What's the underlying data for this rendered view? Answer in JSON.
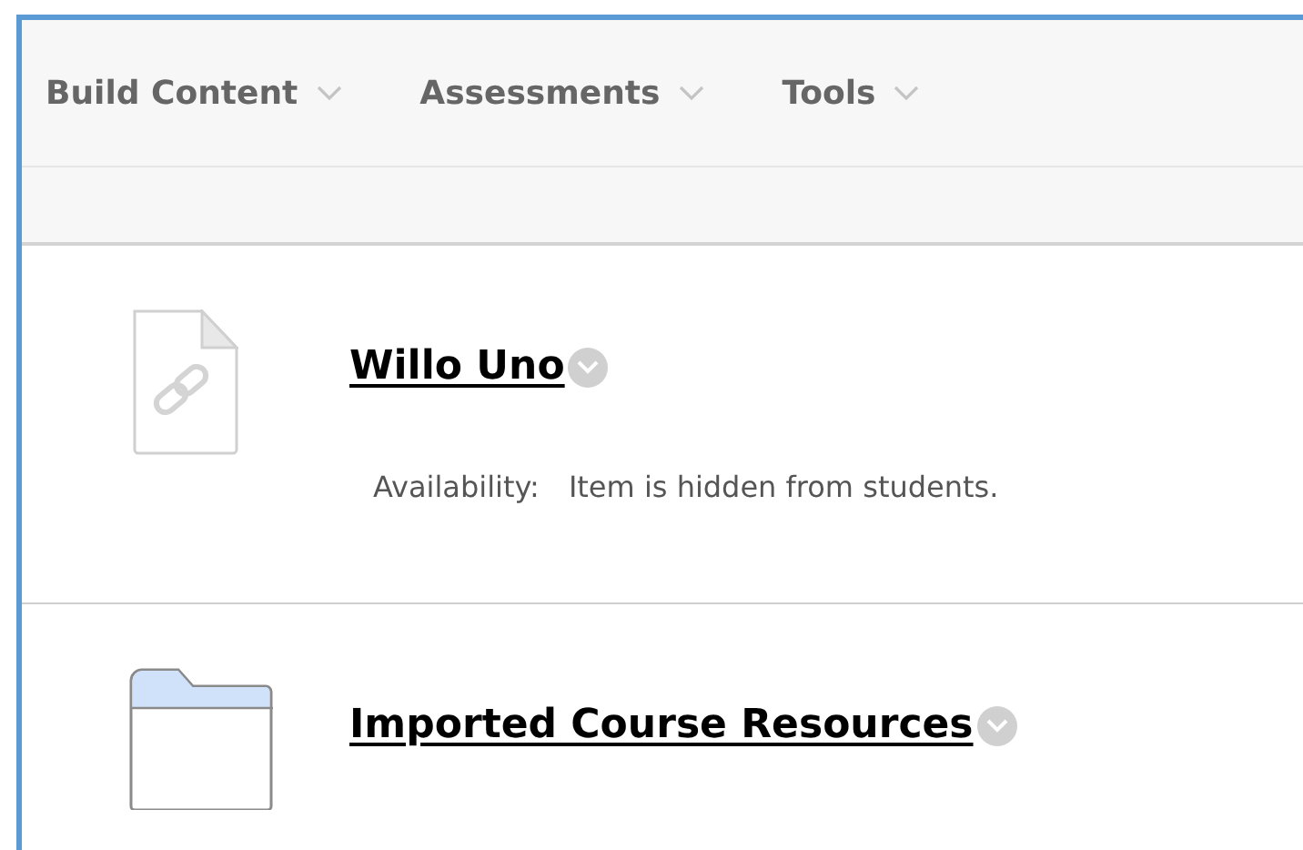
{
  "toolbar": {
    "menus": [
      {
        "label": "Build Content"
      },
      {
        "label": "Assessments"
      },
      {
        "label": "Tools"
      }
    ]
  },
  "items": [
    {
      "kind": "link",
      "title": "Willo Uno",
      "details": [
        {
          "label": "Availability:",
          "value": "Item is hidden from students."
        }
      ]
    },
    {
      "kind": "folder",
      "title": "Imported Course Resources"
    }
  ]
}
